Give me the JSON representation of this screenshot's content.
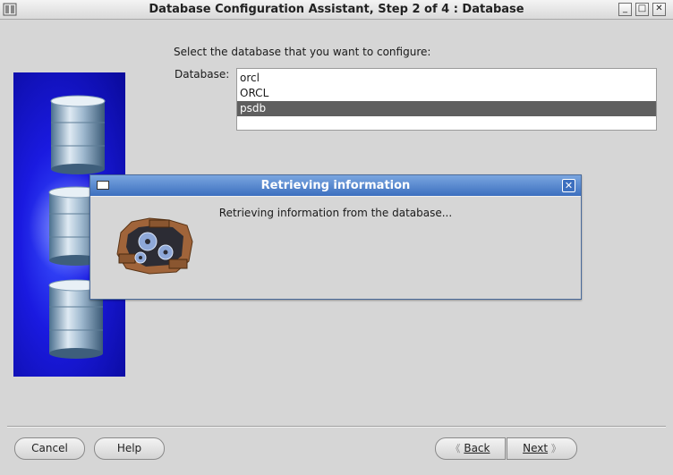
{
  "window": {
    "title": "Database Configuration Assistant, Step 2 of 4 : Database",
    "buttons": {
      "minimize": "_",
      "maximize": "□",
      "close": "✕"
    }
  },
  "main": {
    "prompt": "Select the database that you want to configure:",
    "database_label": "Database:",
    "databases": [
      "orcl",
      "ORCL",
      "psdb"
    ],
    "selected_database": "psdb"
  },
  "footer": {
    "cancel": "Cancel",
    "help": "Help",
    "back": "Back",
    "next": "Next"
  },
  "dialog": {
    "title": "Retrieving information",
    "message": "Retrieving information from the database...",
    "close": "✕"
  },
  "colors": {
    "dialog_title_top": "#7aa6e0",
    "dialog_title_bottom": "#3c6fbf",
    "selection": "#5f5f5f",
    "side_panel": "#1a1ae0"
  }
}
